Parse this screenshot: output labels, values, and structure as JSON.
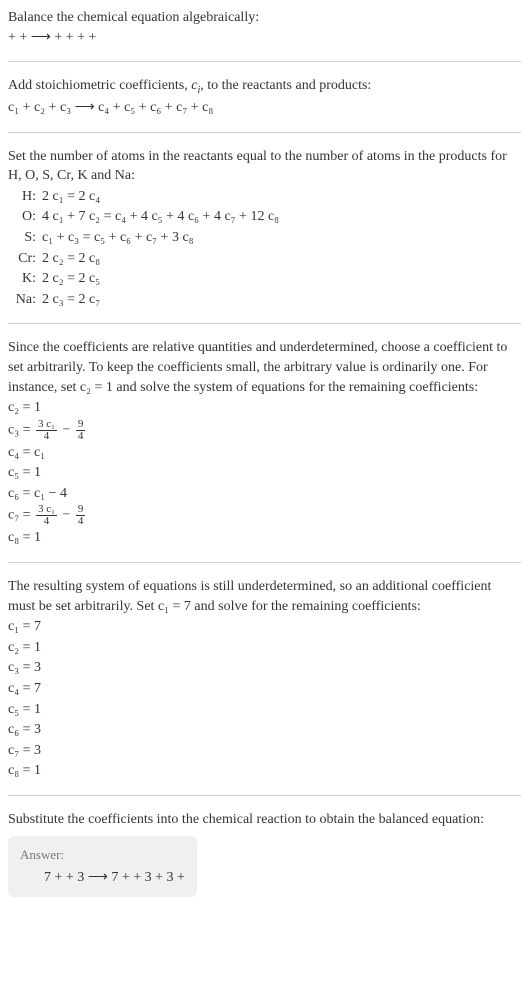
{
  "intro": {
    "line1": "Balance the chemical equation algebraically:",
    "line2": " +  +  ⟶  +  +  +  + "
  },
  "stoich": {
    "text": "Add stoichiometric coefficients, ",
    "ci": "c",
    "ci_sub": "i",
    "text2": ", to the reactants and products:",
    "eq": "c₁  + c₂  + c₃  ⟶ c₄  + c₅  + c₆  + c₇  + c₈"
  },
  "atoms": {
    "text": "Set the number of atoms in the reactants equal to the number of atoms in the products for H, O, S, Cr, K and Na:",
    "rows": [
      {
        "el": "H:",
        "eq": "2 c₁ = 2 c₄"
      },
      {
        "el": "O:",
        "eq": "4 c₁ + 7 c₂ = c₄ + 4 c₅ + 4 c₆ + 4 c₇ + 12 c₈"
      },
      {
        "el": "S:",
        "eq": "c₁ + c₃ = c₅ + c₆ + c₇ + 3 c₈"
      },
      {
        "el": "Cr:",
        "eq": "2 c₂ = 2 c₈"
      },
      {
        "el": "K:",
        "eq": "2 c₂ = 2 c₅"
      },
      {
        "el": "Na:",
        "eq": "2 c₃ = 2 c₇"
      }
    ]
  },
  "under1": {
    "text": "Since the coefficients are relative quantities and underdetermined, choose a coefficient to set arbitrarily. To keep the coefficients small, the arbitrary value is ordinarily one. For instance, set c₂ = 1 and solve the system of equations for the remaining coefficients:",
    "c2": "c₂ = 1",
    "c3_pre": "c₃ = ",
    "c3_num1": "3 c₁",
    "c3_den1": "4",
    "c3_mid": " − ",
    "c3_num2": "9",
    "c3_den2": "4",
    "c4": "c₄ = c₁",
    "c5": "c₅ = 1",
    "c6": "c₆ = c₁ − 4",
    "c7_pre": "c₇ = ",
    "c7_num1": "3 c₁",
    "c7_den1": "4",
    "c7_mid": " − ",
    "c7_num2": "9",
    "c7_den2": "4",
    "c8": "c₈ = 1"
  },
  "under2": {
    "text": "The resulting system of equations is still underdetermined, so an additional coefficient must be set arbitrarily. Set c₁ = 7 and solve for the remaining coefficients:",
    "lines": [
      "c₁ = 7",
      "c₂ = 1",
      "c₃ = 3",
      "c₄ = 7",
      "c₅ = 1",
      "c₆ = 3",
      "c₇ = 3",
      "c₈ = 1"
    ]
  },
  "subst": {
    "text": "Substitute the coefficients into the chemical reaction to obtain the balanced equation:"
  },
  "answer": {
    "label": "Answer:",
    "eq": "7  +  + 3  ⟶ 7  +  + 3  + 3  + "
  }
}
